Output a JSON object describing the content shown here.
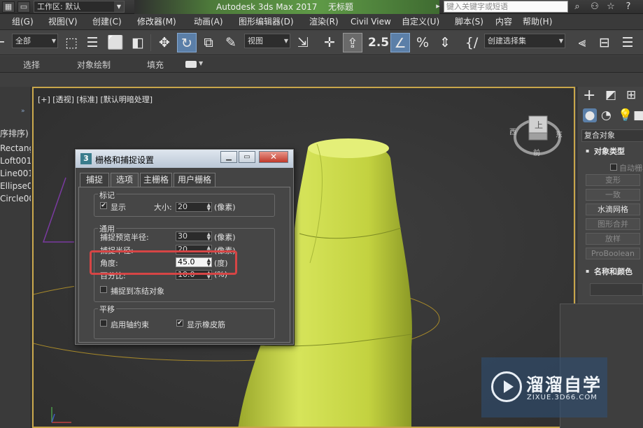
{
  "titlebar": {
    "workspace_label": "工作区: 默认",
    "app_name": "Autodesk 3ds Max 2017",
    "file_name": "无标题",
    "search_placeholder": "键入关键字或短语"
  },
  "menubar": {
    "items": [
      "组(G)",
      "视图(V)",
      "创建(C)",
      "修改器(M)",
      "动画(A)",
      "图形编辑器(D)",
      "渲染(R)",
      "Civil View",
      "自定义(U)",
      "脚本(S)",
      "内容",
      "帮助(H)"
    ]
  },
  "maintoolbar": {
    "filter_value": "全部",
    "refcoord_value": "视图",
    "selection_set_value": "创建选择集",
    "snap_label": "2.5"
  },
  "ribbon": {
    "tabs": [
      "选择",
      "对象绘制",
      "填充"
    ]
  },
  "scene_explorer": {
    "header": "序排序)",
    "items": [
      "Rectang",
      "Loft001",
      "Line001",
      "Ellipse00",
      "Circle00"
    ]
  },
  "viewport": {
    "label": "[+] [透视] [标准] [默认明暗处理]",
    "viewcube": {
      "top": "上",
      "front": "前",
      "east": "东",
      "west": "西"
    }
  },
  "dialog": {
    "title": "栅格和捕捉设置",
    "title_icon": "3",
    "tabs": [
      "捕捉",
      "选项",
      "主栅格",
      "用户栅格"
    ],
    "active_tab": "选项",
    "markers": {
      "group_title": "标记",
      "display_label": "显示",
      "display_checked": true,
      "size_label": "大小:",
      "size_value": "20",
      "size_unit": "(像素)"
    },
    "general": {
      "group_title": "通用",
      "preview_radius_label": "捕捉预览半径:",
      "preview_radius_value": "30",
      "preview_radius_unit": "(像素)",
      "snap_radius_label": "捕捉半径:",
      "snap_radius_value": "20",
      "snap_radius_unit": "(像素)",
      "angle_label": "角度:",
      "angle_value": "45.0",
      "angle_unit": "(度)",
      "percent_label": "百分比:",
      "percent_value": "10.0",
      "percent_unit": "(%)",
      "frozen_label": "捕捉到冻结对象",
      "frozen_checked": false
    },
    "translation": {
      "group_title": "平移",
      "axis_constraint_label": "启用轴约束",
      "axis_constraint_checked": false,
      "rubberband_label": "显示橡皮筋",
      "rubberband_checked": true
    }
  },
  "command_panel": {
    "category": "复合对象",
    "object_type_title": "对象类型",
    "auto_grid_label": "自动栅格",
    "buttons": [
      "变形",
      "一致",
      "水滴网格",
      "图形合并",
      "放样",
      "ProBoolean"
    ],
    "enabled_buttons": [
      false,
      false,
      true,
      false,
      false,
      true
    ],
    "name_color_title": "名称和颜色"
  },
  "watermark": {
    "text": "溜溜自学",
    "sub": "ZIXUE.3D66.COM"
  },
  "colors": {
    "object": "#c9d94a",
    "viewport_border": "#c8a64a",
    "highlight": "#d64545",
    "active_tool": "#5b7fa8"
  }
}
